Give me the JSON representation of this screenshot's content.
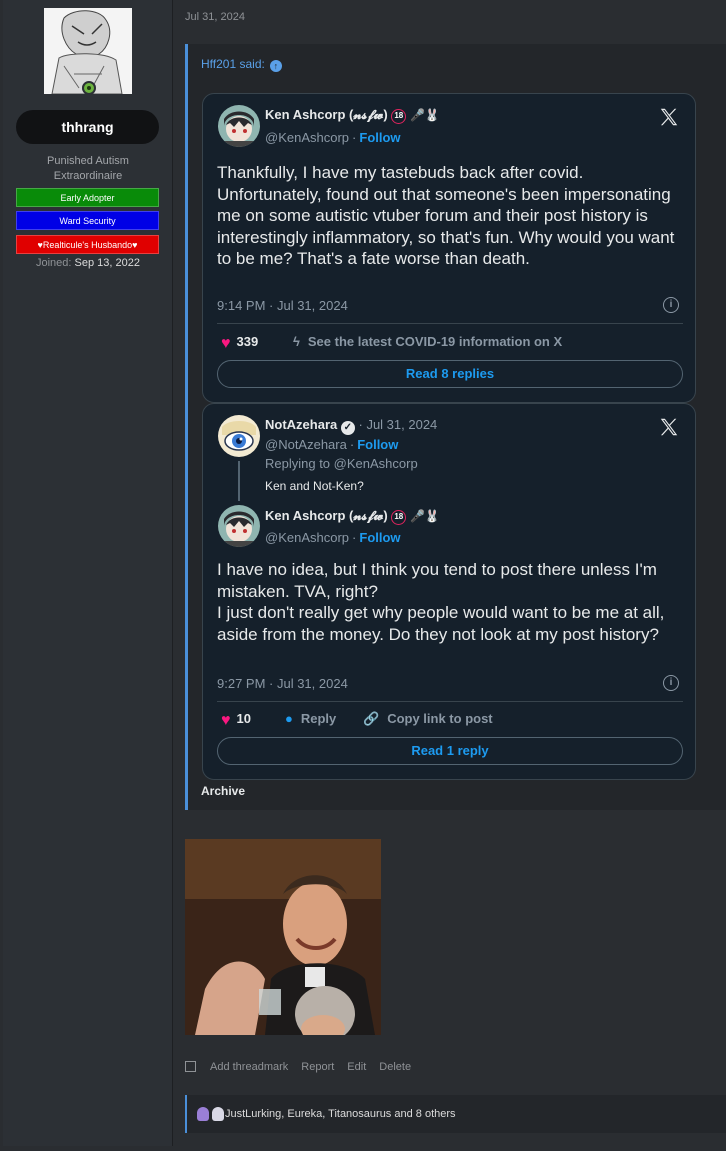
{
  "user": {
    "name": "thhrang",
    "title": "Punished Autism Extraordinaire",
    "banners": [
      "Early Adopter",
      "Ward Security",
      "♥Realticule's Husbando♥"
    ],
    "joined_label": "Joined:",
    "joined_date": "Sep 13, 2022"
  },
  "post": {
    "date": "Jul 31, 2024",
    "quote_author": "Hff201 said:",
    "archive_label": "Archive"
  },
  "tweet1": {
    "name": "Ken Ashcorp (𝓷𝓼𝓯𝔀)",
    "emoji": "🎤🐰",
    "handle": "@KenAshcorp",
    "follow": "Follow",
    "text": "Thankfully, I have my tastebuds back after covid. Unfortunately, found out that someone's been impersonating me on some autistic vtuber forum and their post history is interestingly inflammatory, so that's fun. Why would you want to be me? That's a fate worse than death.",
    "time": "9:14 PM · Jul 31, 2024",
    "likes": "339",
    "covid_link": "See the latest COVID-19 information on X",
    "read_replies": "Read 8 replies"
  },
  "tweet2": {
    "parent_name": "NotAzehara",
    "parent_date": "Jul 31, 2024",
    "parent_handle": "@NotAzehara",
    "follow": "Follow",
    "replying_to": "Replying to @KenAshcorp",
    "parent_text": "Ken and Not-Ken?",
    "name": "Ken Ashcorp (𝓷𝓼𝓯𝔀)",
    "emoji": "🎤🐰",
    "handle": "@KenAshcorp",
    "text": "I have no idea, but I think you tend to post there unless I'm mistaken. TVA, right?\nI just don't really get why people would want to be me at all, aside from the money. Do they not look at my post history?",
    "time": "9:27 PM · Jul 31, 2024",
    "likes": "10",
    "reply": "Reply",
    "copy_link": "Copy link to post",
    "read_replies": "Read 1 reply"
  },
  "footer": {
    "add_threadmark": "Add threadmark",
    "report": "Report",
    "edit": "Edit",
    "delete": "Delete",
    "reactions_text": "JustLurking, Eureka, Titanosaurus and 8 others"
  },
  "colors": {
    "accent_blue": "#4a8fd9",
    "twitter_bg": "#15202b",
    "twitter_link": "#1d9bf0",
    "heart": "#f91880"
  }
}
